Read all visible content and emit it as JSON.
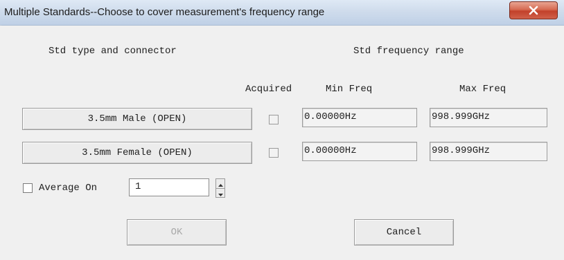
{
  "window": {
    "title": "Multiple Standards--Choose to cover measurement's frequency range"
  },
  "headers": {
    "std_type": "Std type and connector",
    "std_range": "Std frequency range",
    "acquired": "Acquired",
    "min_freq": "Min Freq",
    "max_freq": "Max Freq"
  },
  "standards": [
    {
      "label": "3.5mm Male (OPEN)",
      "acquired": false,
      "min_freq": "0.00000Hz",
      "max_freq": "998.999GHz"
    },
    {
      "label": "3.5mm Female (OPEN)",
      "acquired": false,
      "min_freq": "0.00000Hz",
      "max_freq": "998.999GHz"
    }
  ],
  "average": {
    "label": "Average On",
    "checked": false,
    "value": "1"
  },
  "buttons": {
    "ok": "OK",
    "cancel": "Cancel"
  },
  "icons": {
    "close": "close-icon",
    "spin_up": "arrow-up-icon",
    "spin_down": "arrow-down-icon"
  }
}
